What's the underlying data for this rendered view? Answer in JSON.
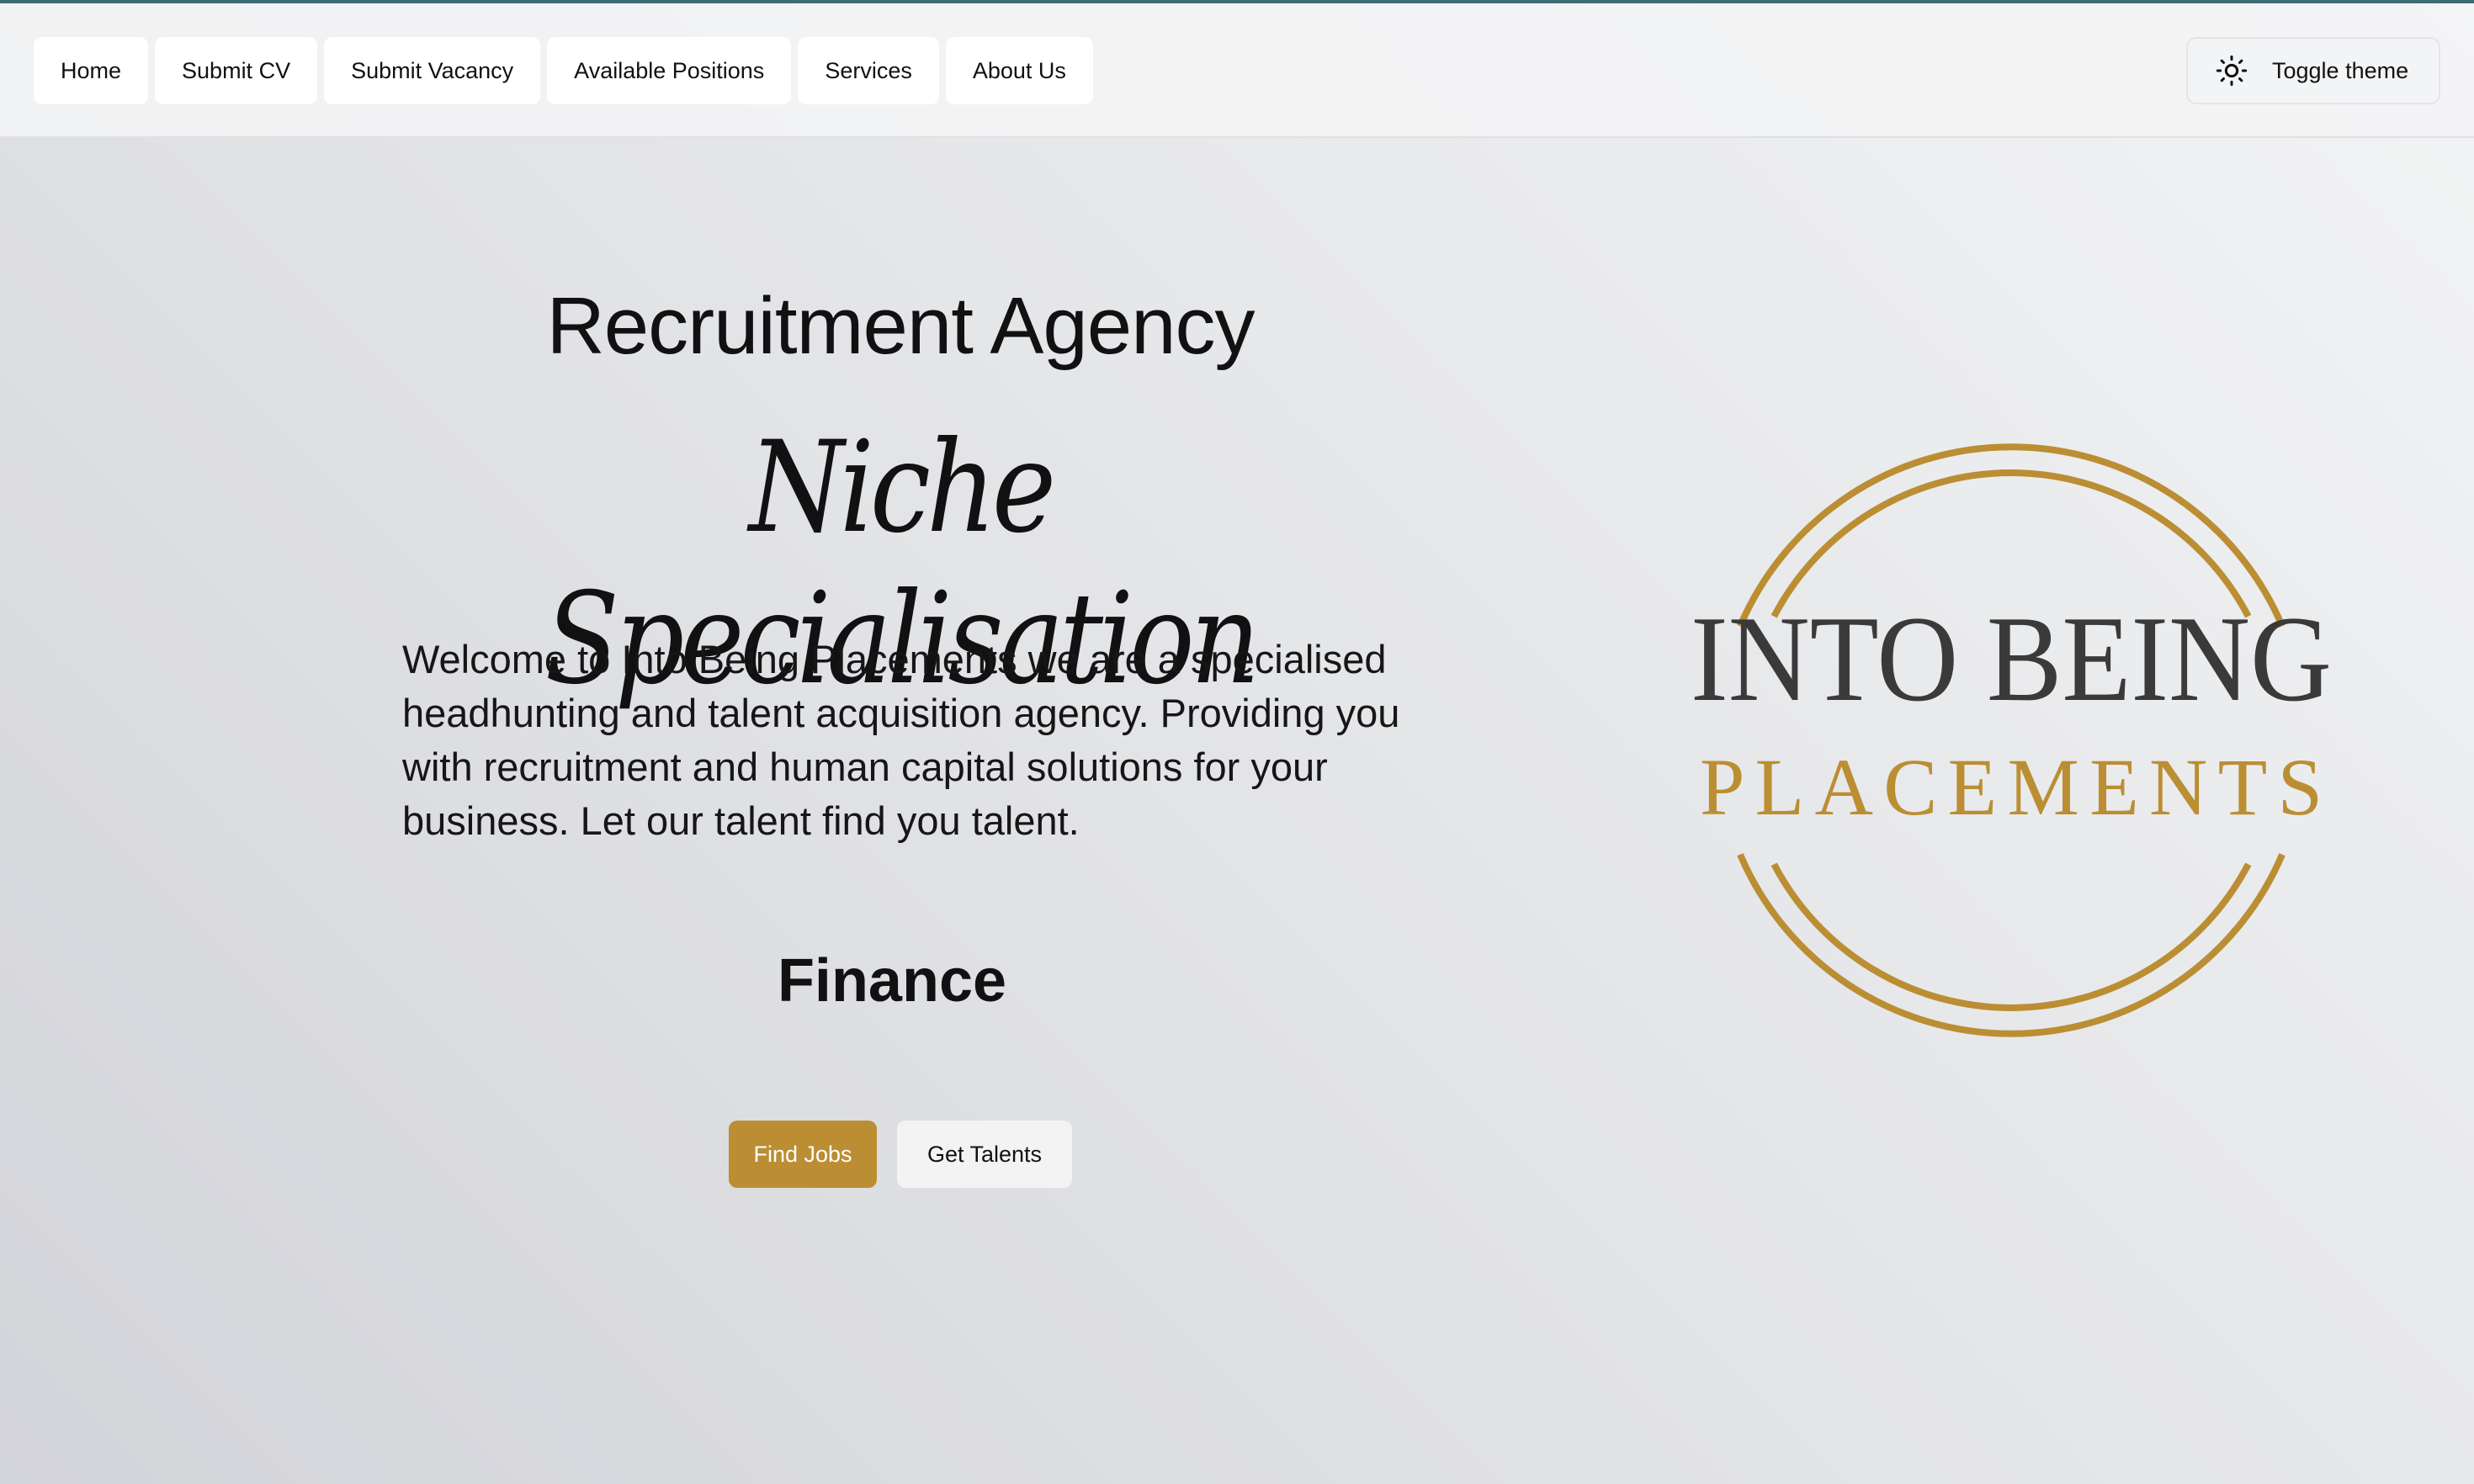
{
  "nav": {
    "items": [
      {
        "label": "Home"
      },
      {
        "label": "Submit CV"
      },
      {
        "label": "Submit Vacancy"
      },
      {
        "label": "Available Positions"
      },
      {
        "label": "Services"
      },
      {
        "label": "About Us"
      }
    ],
    "theme_toggle": {
      "label": "Toggle theme",
      "icon": "sun-icon"
    }
  },
  "hero": {
    "title": "Recruitment Agency",
    "script_title": "Niche Specialisation",
    "description": "Welcome to Into Being Placements we are a specialised headhunting and talent acquisition agency. Providing you with recruitment and human capital solutions for your business. Let our talent find you talent.",
    "focus": "Finance",
    "primary_button": "Find Jobs",
    "secondary_button": "Get Talents"
  },
  "logo": {
    "line1": "INTO BEING",
    "line2": "PLACEMENTS"
  },
  "colors": {
    "accent": "#bb8e33",
    "top_bar": "#3d6b78",
    "logo_dark": "#3a3a3a"
  }
}
